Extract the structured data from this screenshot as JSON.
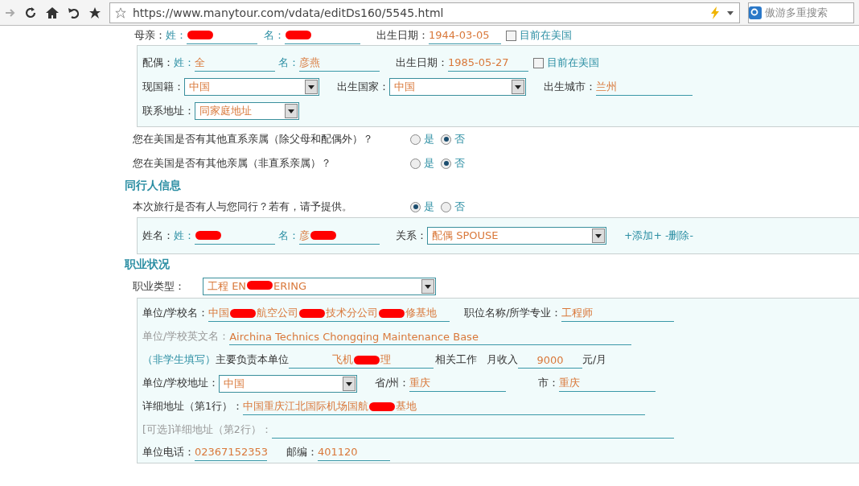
{
  "toolbar": {
    "url": "https://www.manytour.com/vdata/editDs160/5545.html",
    "search_placeholder": "傲游多重搜索"
  },
  "mother": {
    "label": "母亲：",
    "surname_label": "姓：",
    "surname": [
      {
        "kind": "redaction"
      }
    ],
    "given_label": "名：",
    "given": [
      {
        "kind": "redaction"
      }
    ],
    "birth_label": "出生日期：",
    "birth": "1944-03-05",
    "in_us": {
      "label": "目前在美国",
      "checked": false
    }
  },
  "spouse": {
    "label": "配偶：",
    "surname_label": "姓：",
    "surname": "全",
    "given_label": "名：",
    "given": "彦燕",
    "birth_label": "出生日期：",
    "birth": "1985-05-27",
    "in_us": {
      "label": "目前在美国",
      "checked": false
    },
    "nationality_label": "现国籍：",
    "nationality": "中国",
    "birth_country_label": "出生国家：",
    "birth_country": "中国",
    "birth_city_label": "出生城市：",
    "birth_city": "兰州",
    "address_label": "联系地址：",
    "address": "同家庭地址"
  },
  "relatives_questions": [
    {
      "text": "您在美国是否有其他直系亲属（除父母和配偶外）？",
      "options": [
        {
          "label": "是",
          "selected": false
        },
        {
          "label": "否",
          "selected": true
        }
      ]
    },
    {
      "text": "您在美国是否有其他亲属（非直系亲属）？",
      "options": [
        {
          "label": "是",
          "selected": false
        },
        {
          "label": "否",
          "selected": true
        }
      ]
    }
  ],
  "companions": {
    "heading": "同行人信息",
    "question": {
      "text": "本次旅行是否有人与您同行？若有，请予提供。",
      "options": [
        {
          "label": "是",
          "selected": true
        },
        {
          "label": "否",
          "selected": false
        }
      ]
    },
    "entries": [
      {
        "label": "姓名：",
        "surname_label": "姓：",
        "surname": [
          {
            "kind": "redaction"
          }
        ],
        "given_label": "名：",
        "given": [
          {
            "kind": "text",
            "text": "彦"
          },
          {
            "kind": "redaction"
          }
        ],
        "relation_label": "关系：",
        "relation": "配偶 SPOUSE"
      }
    ],
    "add": "+添加+",
    "remove": "-删除-"
  },
  "occupation": {
    "heading": "职业状况",
    "type_label": "职业类型：",
    "type": [
      {
        "kind": "text",
        "text": "工程 EN"
      },
      {
        "kind": "redaction"
      },
      {
        "kind": "text",
        "text": "ERING"
      }
    ],
    "employer_label": "单位/学校名：",
    "employer": [
      {
        "kind": "text",
        "text": "中国"
      },
      {
        "kind": "redaction"
      },
      {
        "kind": "text",
        "text": "航空公司"
      },
      {
        "kind": "redaction"
      },
      {
        "kind": "text",
        "text": "技术分公司"
      },
      {
        "kind": "redaction"
      },
      {
        "kind": "text",
        "text": "修基地"
      }
    ],
    "position_label": "职位名称/所学专业：",
    "position": "工程师",
    "employer_en_label": "单位/学校英文名：",
    "employer_en": "Airchina Technics Chongqing Maintenance Base",
    "non_student_note": "（非学生填写）",
    "duty_label": "主要负责本单位",
    "duty": [
      {
        "kind": "text",
        "text": "飞机"
      },
      {
        "kind": "redaction"
      },
      {
        "kind": "text",
        "text": "理"
      }
    ],
    "duty_suffix": "相关工作",
    "income_label": "月收入",
    "income": "9000",
    "income_unit": "元/月",
    "address_label": "单位/学校地址：",
    "country": "中国",
    "province_label": "省/州：",
    "province": "重庆",
    "city_label": "市：",
    "city": "重庆",
    "line1_label": "详细地址（第1行）：",
    "line1": [
      {
        "kind": "text",
        "text": "中国重庆江北国际机场国航"
      },
      {
        "kind": "redaction"
      },
      {
        "kind": "text",
        "text": "基地"
      }
    ],
    "line2_label": "[可选]详细地址（第2行）：",
    "phone_label": "单位电话：",
    "phone": "02367152353",
    "zip_label": "邮编：",
    "zip": "401120"
  }
}
